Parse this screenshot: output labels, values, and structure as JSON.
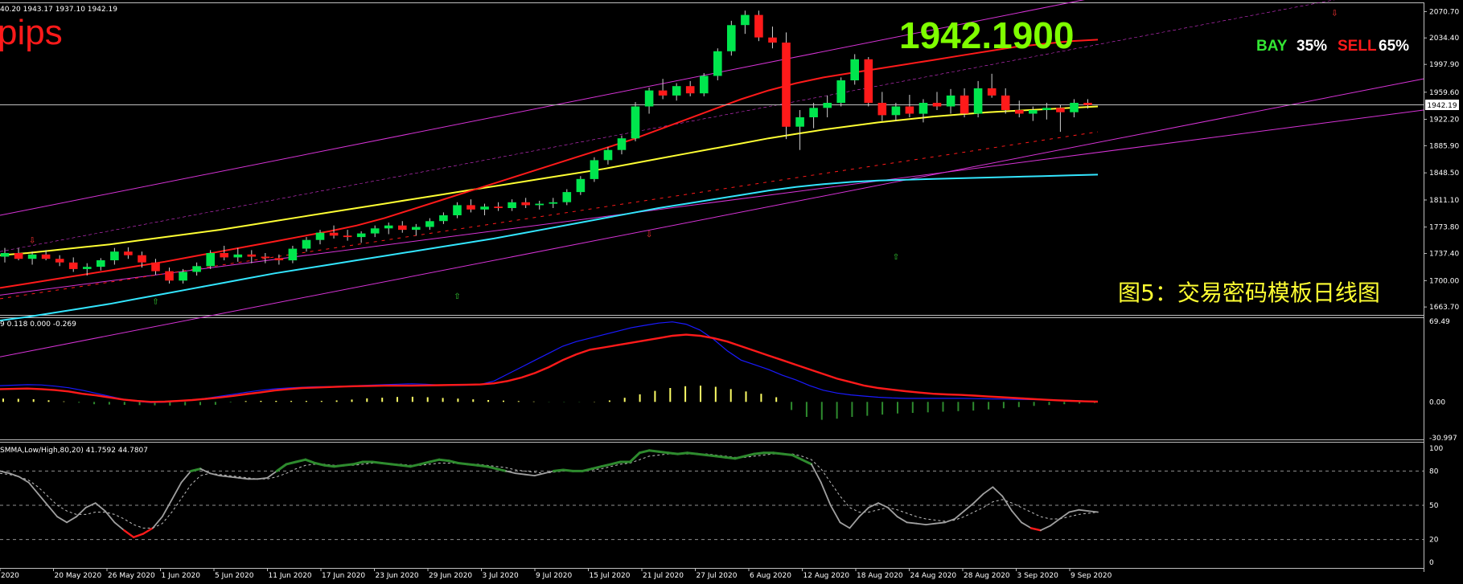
{
  "colors": {
    "background": "#000000",
    "bull": "#00e64d",
    "bear": "#ff1a1a",
    "ma_red": "#ff1a1a",
    "ma_yellow": "#ffff33",
    "ma_cyan": "#33e6ff",
    "channel": "#d633d6",
    "macd_signal": "#ff1a1a",
    "macd_main": "#1a1aff",
    "hist_pos": "#ffff66",
    "hist_neg": "#2e8b2e",
    "stoch_main": "#a0a0a0",
    "stoch_hi": "#2e8b2e",
    "stoch_lo": "#ff1a1a",
    "price_label": "#7fff00",
    "caption": "#ffff33"
  },
  "header": {
    "ohlc": "40.20 1943.17 1937.10 1942.19",
    "pips": "pips",
    "price": "1942.1900",
    "bay_label": "BAY",
    "bay_pct": "35%",
    "sell_label": "SELL",
    "sell_pct": "65%",
    "caption": "图5：交易密码模板日线图"
  },
  "chart_data": [
    {
      "type": "candlestick",
      "price_box": "1942.19",
      "y_ticks": [
        "2070.70",
        "2034.40",
        "1997.90",
        "1959.60",
        "1922.20",
        "1885.90",
        "1848.50",
        "1811.10",
        "1773.80",
        "1737.40",
        "1700.00",
        "1663.70"
      ],
      "ylim": [
        1655,
        2080
      ],
      "x_labels": [
        "2020",
        "20 May 2020",
        "26 May 2020",
        "1 Jun 2020",
        "5 Jun 2020",
        "11 Jun 2020",
        "17 Jun 2020",
        "23 Jun 2020",
        "29 Jun 2020",
        "3 Jul 2020",
        "9 Jul 2020",
        "15 Jul 2020",
        "21 Jul 2020",
        "27 Jul 2020",
        "6 Aug 2020",
        "12 Aug 2020",
        "18 Aug 2020",
        "24 Aug 2020",
        "28 Aug 2020",
        "3 Sep 2020",
        "9 Sep 2020"
      ],
      "candles": [
        [
          1733,
          1745,
          1725,
          1738
        ],
        [
          1738,
          1745,
          1728,
          1730
        ],
        [
          1730,
          1740,
          1722,
          1736
        ],
        [
          1736,
          1742,
          1728,
          1730
        ],
        [
          1730,
          1735,
          1720,
          1725
        ],
        [
          1725,
          1732,
          1712,
          1716
        ],
        [
          1716,
          1724,
          1707,
          1719
        ],
        [
          1719,
          1731,
          1714,
          1728
        ],
        [
          1728,
          1745,
          1722,
          1740
        ],
        [
          1740,
          1746,
          1730,
          1735
        ],
        [
          1735,
          1740,
          1718,
          1725
        ],
        [
          1725,
          1730,
          1708,
          1713
        ],
        [
          1713,
          1718,
          1696,
          1700
        ],
        [
          1700,
          1716,
          1696,
          1712
        ],
        [
          1712,
          1725,
          1707,
          1720
        ],
        [
          1720,
          1742,
          1716,
          1738
        ],
        [
          1738,
          1748,
          1728,
          1732
        ],
        [
          1732,
          1745,
          1726,
          1736
        ],
        [
          1736,
          1742,
          1724,
          1733
        ],
        [
          1733,
          1738,
          1724,
          1731
        ],
        [
          1731,
          1736,
          1722,
          1728
        ],
        [
          1728,
          1748,
          1724,
          1744
        ],
        [
          1744,
          1760,
          1740,
          1756
        ],
        [
          1756,
          1770,
          1750,
          1766
        ],
        [
          1766,
          1776,
          1758,
          1762
        ],
        [
          1762,
          1770,
          1755,
          1760
        ],
        [
          1760,
          1768,
          1752,
          1765
        ],
        [
          1765,
          1776,
          1760,
          1772
        ],
        [
          1772,
          1780,
          1764,
          1776
        ],
        [
          1776,
          1782,
          1766,
          1770
        ],
        [
          1770,
          1778,
          1762,
          1774
        ],
        [
          1774,
          1786,
          1770,
          1782
        ],
        [
          1782,
          1794,
          1778,
          1790
        ],
        [
          1790,
          1808,
          1786,
          1804
        ],
        [
          1804,
          1812,
          1794,
          1798
        ],
        [
          1798,
          1806,
          1790,
          1802
        ],
        [
          1802,
          1808,
          1796,
          1800
        ],
        [
          1800,
          1812,
          1796,
          1808
        ],
        [
          1808,
          1814,
          1800,
          1804
        ],
        [
          1804,
          1810,
          1798,
          1806
        ],
        [
          1806,
          1814,
          1800,
          1808
        ],
        [
          1808,
          1826,
          1804,
          1822
        ],
        [
          1822,
          1844,
          1818,
          1840
        ],
        [
          1840,
          1870,
          1836,
          1866
        ],
        [
          1866,
          1884,
          1860,
          1880
        ],
        [
          1880,
          1900,
          1874,
          1896
        ],
        [
          1896,
          1946,
          1892,
          1940
        ],
        [
          1940,
          1966,
          1930,
          1962
        ],
        [
          1962,
          1978,
          1950,
          1955
        ],
        [
          1955,
          1972,
          1948,
          1968
        ],
        [
          1968,
          1975,
          1954,
          1958
        ],
        [
          1958,
          1986,
          1954,
          1982
        ],
        [
          1982,
          2020,
          1976,
          2016
        ],
        [
          2016,
          2058,
          2010,
          2052
        ],
        [
          2052,
          2072,
          2040,
          2066
        ],
        [
          2066,
          2072,
          2030,
          2035
        ],
        [
          2035,
          2050,
          2020,
          2028
        ],
        [
          2028,
          2042,
          1895,
          1912
        ],
        [
          1912,
          1935,
          1880,
          1925
        ],
        [
          1925,
          1945,
          1910,
          1938
        ],
        [
          1938,
          1955,
          1925,
          1945
        ],
        [
          1945,
          1980,
          1940,
          1976
        ],
        [
          1976,
          2012,
          1970,
          2005
        ],
        [
          2005,
          2008,
          1940,
          1945
        ],
        [
          1945,
          1960,
          1920,
          1928
        ],
        [
          1928,
          1945,
          1920,
          1940
        ],
        [
          1940,
          1956,
          1925,
          1930
        ],
        [
          1930,
          1950,
          1918,
          1945
        ],
        [
          1945,
          1960,
          1935,
          1940
        ],
        [
          1940,
          1964,
          1930,
          1955
        ],
        [
          1955,
          1965,
          1925,
          1930
        ],
        [
          1930,
          1975,
          1925,
          1965
        ],
        [
          1965,
          1985,
          1952,
          1955
        ],
        [
          1955,
          1965,
          1930,
          1935
        ],
        [
          1935,
          1948,
          1925,
          1930
        ],
        [
          1930,
          1940,
          1920,
          1935
        ],
        [
          1935,
          1945,
          1922,
          1938
        ],
        [
          1938,
          1942,
          1905,
          1932
        ],
        [
          1932,
          1950,
          1925,
          1945
        ],
        [
          1945,
          1950,
          1937,
          1942
        ]
      ],
      "ma_red": [
        1690,
        1696,
        1702,
        1708,
        1714,
        1720,
        1726,
        1733,
        1740,
        1747,
        1754,
        1761,
        1768,
        1776,
        1786,
        1798,
        1810,
        1822,
        1834,
        1846,
        1858,
        1870,
        1882,
        1894,
        1908,
        1922,
        1936,
        1950,
        1962,
        1972,
        1980,
        1986,
        1992,
        1998,
        2004,
        2010,
        2016,
        2022,
        2026,
        2030,
        2032
      ],
      "ma_yellow": [
        1735,
        1738,
        1742,
        1746,
        1750,
        1755,
        1760,
        1765,
        1770,
        1776,
        1782,
        1788,
        1794,
        1800,
        1806,
        1812,
        1818,
        1824,
        1830,
        1836,
        1842,
        1848,
        1854,
        1861,
        1868,
        1875,
        1882,
        1889,
        1896,
        1902,
        1908,
        1913,
        1918,
        1922,
        1926,
        1929,
        1932,
        1934,
        1936,
        1938,
        1940
      ],
      "ma_cyan": [
        1645,
        1650,
        1656,
        1662,
        1668,
        1675,
        1682,
        1689,
        1696,
        1703,
        1710,
        1716,
        1722,
        1728,
        1734,
        1740,
        1746,
        1752,
        1758,
        1765,
        1772,
        1779,
        1786,
        1793,
        1800,
        1806,
        1812,
        1818,
        1824,
        1829,
        1833,
        1836,
        1838,
        1839,
        1840,
        1841,
        1842,
        1843,
        1844,
        1845,
        1846
      ]
    },
    {
      "type": "line",
      "header": "9 0.118 0.000 -0.269",
      "y_ticks": [
        "69.49",
        "0.00",
        "-30.997"
      ],
      "ylim": [
        -31,
        69.5
      ],
      "series": [
        {
          "values": [
            11,
            11.2,
            11.5,
            11,
            10.2,
            9,
            7,
            5.6,
            3.8,
            2,
            0.8,
            0,
            0.2,
            0.8,
            1.6,
            2.6,
            3.8,
            5.2,
            6.8,
            8.2,
            9.8,
            11,
            12,
            12.4,
            12.8,
            13.2,
            13.6,
            13.8,
            14,
            14,
            14,
            14.2,
            14.4,
            14.6,
            14.8,
            15,
            16,
            18,
            21,
            25,
            30,
            36,
            41,
            45,
            47,
            49,
            51,
            53,
            55,
            57,
            58,
            57,
            55,
            52,
            48,
            44,
            40,
            36,
            32,
            28,
            24,
            20,
            17,
            14,
            12,
            10.5,
            9.2,
            8,
            7,
            6.4,
            6,
            5.4,
            4.6,
            4,
            3.4,
            2.6,
            2,
            1.4,
            0.9,
            0.5,
            0.2
          ]
        },
        {
          "values": [
            14,
            14.4,
            14.8,
            14.6,
            13.6,
            12.2,
            10,
            7.4,
            4.8,
            2.2,
            0.4,
            -0.6,
            -0.2,
            0.6,
            1.6,
            3,
            4.8,
            6.6,
            8.4,
            10,
            11.2,
            12,
            12.6,
            13,
            13.2,
            13.6,
            14,
            14.4,
            14.8,
            15.2,
            15.6,
            15.2,
            14.6,
            14.2,
            14.4,
            15,
            18,
            24,
            30,
            36,
            42,
            48,
            52,
            55,
            58,
            61,
            64,
            66,
            68,
            69,
            67,
            62,
            54,
            44,
            36,
            32,
            28,
            23,
            19,
            14,
            10,
            7.6,
            6,
            5,
            4,
            3.4,
            3,
            3,
            3,
            3,
            3,
            2.8,
            2.6,
            2.4,
            2.2,
            2,
            1.8,
            1.6,
            1.2,
            0.8,
            0.4
          ]
        }
      ],
      "histogram": [
        2.8,
        2.6,
        2.3,
        1.4,
        0.4,
        -0.7,
        -2.0,
        -2.3,
        -2.6,
        -2.8,
        -3.0,
        -3.2,
        -3.0,
        -2.8,
        -2.5,
        -0.5,
        0.7,
        0.9,
        0.9,
        0.8,
        0.8,
        0.8,
        1.2,
        2,
        3,
        3.6,
        4.2,
        4.4,
        4,
        3.4,
        2.8,
        2.2,
        1.6,
        1.1,
        0.7,
        0.3,
        -0.2,
        -0.3,
        -0.2,
        0.2,
        1.2,
        3.5,
        6.5,
        9.5,
        12,
        13.5,
        14,
        13,
        11,
        9,
        7,
        4,
        -7,
        -13,
        -15.5,
        -14.5,
        -13,
        -12,
        -11,
        -10,
        -9.5,
        -9,
        -8.5,
        -8,
        -7.5,
        -6.5,
        -5.5,
        -4.5,
        -3.5,
        -2.7,
        -2,
        -1.5,
        -1
      ]
    },
    {
      "type": "line",
      "header": "SMMA,Low/High,80,20) 41.7592 44.7807",
      "y_ticks": [
        "100",
        "80",
        "50",
        "20",
        "0"
      ],
      "ylim": [
        0,
        100
      ],
      "levels": [
        80,
        50,
        20
      ],
      "series": [
        {
          "values": [
            80,
            78,
            75,
            70,
            60,
            50,
            40,
            35,
            40,
            48,
            52,
            45,
            35,
            28,
            22,
            25,
            30,
            40,
            55,
            70,
            80,
            82,
            78,
            76,
            75,
            74,
            73,
            73,
            74,
            80,
            86,
            88,
            90,
            87,
            85,
            84,
            85,
            86,
            88,
            88,
            87,
            86,
            85,
            84,
            86,
            88,
            90,
            89,
            87,
            86,
            85,
            84,
            82,
            80,
            78,
            77,
            76,
            78,
            80,
            81,
            80,
            80,
            82,
            84,
            86,
            88,
            88,
            96,
            98,
            97,
            96,
            95,
            96,
            95,
            94,
            93,
            92,
            91,
            93,
            95,
            96,
            96,
            95,
            94,
            90,
            86,
            70,
            50,
            35,
            30,
            40,
            48,
            52,
            48,
            40,
            35,
            34,
            33,
            34,
            35,
            38,
            45,
            52,
            60,
            66,
            58,
            45,
            35,
            30,
            28,
            32,
            38,
            44,
            46,
            45,
            44
          ]
        },
        {
          "values": [
            78,
            77,
            75,
            72,
            66,
            58,
            50,
            45,
            42,
            42,
            44,
            44,
            42,
            38,
            33,
            30,
            30,
            34,
            44,
            56,
            68,
            76,
            78,
            77,
            76,
            75,
            74,
            73,
            73,
            75,
            78,
            82,
            85,
            86,
            86,
            85,
            85,
            85,
            86,
            87,
            87,
            86,
            86,
            85,
            85,
            86,
            87,
            87,
            87,
            86,
            86,
            85,
            84,
            83,
            81,
            80,
            79,
            78,
            79,
            80,
            80,
            80,
            81,
            82,
            84,
            86,
            87,
            90,
            93,
            94,
            95,
            95,
            95,
            95,
            95,
            94,
            93,
            92,
            92,
            93,
            94,
            95,
            95,
            95,
            93,
            90,
            82,
            70,
            58,
            48,
            44,
            44,
            46,
            48,
            46,
            43,
            40,
            38,
            37,
            36,
            37,
            40,
            44,
            48,
            53,
            55,
            52,
            48,
            44,
            40,
            38,
            38,
            40,
            42,
            43,
            44
          ]
        }
      ]
    }
  ]
}
